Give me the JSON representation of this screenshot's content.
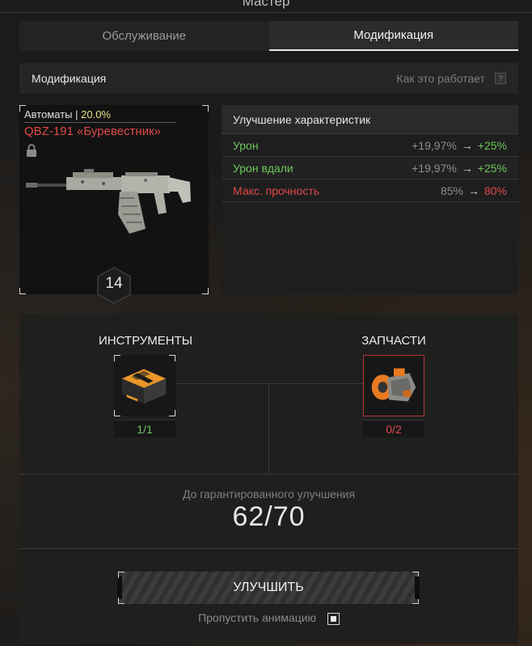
{
  "window": {
    "title": "Мастер"
  },
  "tabs": [
    {
      "label": "Обслуживание",
      "active": false
    },
    {
      "label": "Модификация",
      "active": true
    }
  ],
  "subheader": {
    "title": "Модификация",
    "how_label": "Как это работает",
    "help_glyph": "?"
  },
  "weapon": {
    "category": "Автоматы |",
    "category_pct": "20.0%",
    "name": "QBZ-191 «Буревестник»",
    "level": "14",
    "locked": true
  },
  "stats": {
    "title": "Улучшение характеристик",
    "arrow": "→",
    "rows": [
      {
        "label": "Урон",
        "old": "+19,97%",
        "new": "+25%",
        "color": "#6cc85c"
      },
      {
        "label": "Урон вдали",
        "old": "+19,97%",
        "new": "+25%",
        "color": "#6cc85c"
      },
      {
        "label": "Макс. прочность",
        "old": "85%",
        "new": "80%",
        "color": "#e04848"
      }
    ]
  },
  "materials": {
    "tools": {
      "title": "ИНСТРУМЕНТЫ",
      "count": "1/1",
      "color": "#6cc85c"
    },
    "parts": {
      "title": "ЗАПЧАСТИ",
      "count": "0/2",
      "color": "#e04848"
    }
  },
  "guarantee": {
    "label": "До гарантированного улучшения",
    "value": "62/70"
  },
  "upgrade_button": {
    "label": "УЛУЧШИТЬ"
  },
  "skip_animation": {
    "label": "Пропустить анимацию",
    "checked": true
  }
}
